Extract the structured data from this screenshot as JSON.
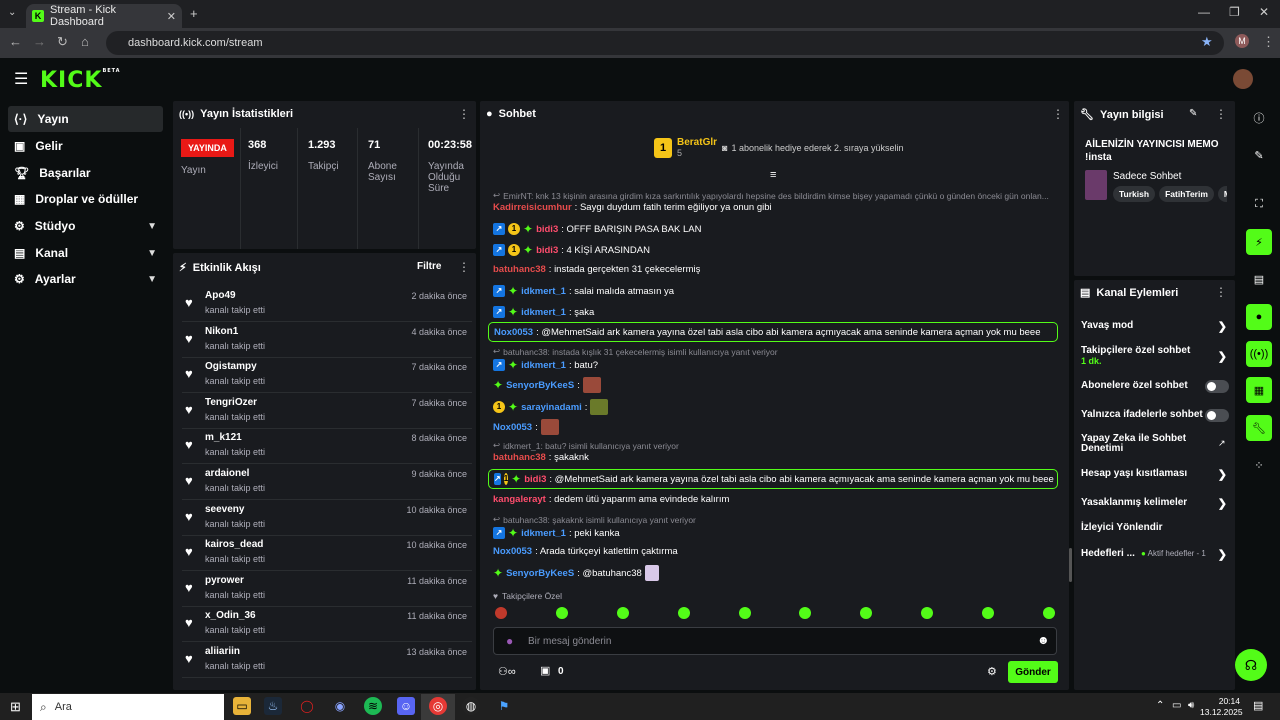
{
  "browser": {
    "tab_title": "Stream - Kick Dashboard",
    "url": "dashboard.kick.com/stream",
    "avatar_letter": "M"
  },
  "kick": {
    "logo": "KICK",
    "logo_sup": "BETA"
  },
  "sidebar": {
    "items": [
      {
        "label": "Yayın"
      },
      {
        "label": "Gelir"
      },
      {
        "label": "Başarılar"
      },
      {
        "label": "Droplar ve ödüller"
      },
      {
        "label": "Stüdyo"
      },
      {
        "label": "Kanal"
      },
      {
        "label": "Ayarlar"
      }
    ]
  },
  "stats": {
    "title": "Yayın İstatistikleri",
    "live": "YAYINDA",
    "live_label": "Yayın",
    "viewers": "368",
    "viewers_label": "İzleyici",
    "followers": "1.293",
    "followers_label": "Takipçi",
    "subs": "71",
    "subs_label": "Abone Sayısı",
    "duration": "00:23:58",
    "duration_label": "Yayında Olduğu Süre"
  },
  "activity": {
    "title": "Etkinlik Akışı",
    "filter": "Filtre",
    "sub": "kanalı takip etti",
    "events": [
      {
        "name": "Apo49",
        "time": "2 dakika önce"
      },
      {
        "name": "Nikon1",
        "time": "4 dakika önce"
      },
      {
        "name": "Ogistampy",
        "time": "7 dakika önce"
      },
      {
        "name": "TengriOzer",
        "time": "7 dakika önce"
      },
      {
        "name": "m_k121",
        "time": "8 dakika önce"
      },
      {
        "name": "ardaionel",
        "time": "9 dakika önce"
      },
      {
        "name": "seeveny",
        "time": "10 dakika önce"
      },
      {
        "name": "kairos_dead",
        "time": "10 dakika önce"
      },
      {
        "name": "pyrower",
        "time": "11 dakika önce"
      },
      {
        "name": "x_Odin_36",
        "time": "11 dakika önce"
      },
      {
        "name": "aliiariin",
        "time": "13 dakika önce"
      }
    ]
  },
  "chat": {
    "title": "Sohbet",
    "top_gifter": "BeratGlr",
    "top_gifter_count": "5",
    "gift_msg": "1 abonelik hediye ederek 2. sıraya yükselin",
    "l0": "EmirNT: knk 13 kişinin arasına girdim kıza sarkıntılık yapıyolardı hepsine des bildirdim kimse bişey yapamadı çünkü o günden önceki gün onlan...",
    "l1u": "Kadirreisicumhur",
    "l1m": ": Saygı duydum fatih terim eğiliyor ya onun gibi",
    "l2u": "bidi3",
    "l2m": ": OFFF BARIŞIN PASA BAK LAN",
    "l3u": "bidi3",
    "l3m": ": 4 KİŞİ ARASINDAN",
    "l4u": "batuhanc38",
    "l4m": ": instada gerçekten 31 çekecelermiş",
    "l5u": "idkmert_1",
    "l5m": ": salai malıda atmasın ya",
    "l6u": "idkmert_1",
    "l6m": ": şaka",
    "l7u": "Nox0053",
    "l7m": ": @MehmetSaid ark kamera yayına özel tabi asla cibo abi kamera açmıyacak ama seninde kamera açman yok mu beee",
    "r1": "batuhanc38: instada kışlık 31 çekecelermiş isimli kullanıcıya yanıt veriyor",
    "l8u": "idkmert_1",
    "l8m": ": batu?",
    "l9u": "SenyorByKeeS",
    "l9m": ":",
    "l10u": "sarayinadami",
    "l10m": ":",
    "l11u": "Nox0053",
    "l11m": ":",
    "r2": "idkmert_1: batu? isimli kullanıcıya yanıt veriyor",
    "l12u": "batuhanc38",
    "l12m": ": şakaknk",
    "l13u": "bidi3",
    "l13m": ": @MehmetSaid ark kamera yayına özel tabi asla cibo abi kamera açmıyacak ama seninde kamera açman yok mu beee",
    "l14u": "kangalerayt",
    "l14m": ": dedem ütü yaparım ama evindede kalırım",
    "r3": "batuhanc38: şakaknk isimli kullanıcıya yanıt veriyor",
    "l15u": "idkmert_1",
    "l15m": ": peki kanka",
    "l16u": "Nox0053",
    "l16m": ": Arada türkçeyi katlettim çaktırma",
    "l17u": "SenyorByKeeS",
    "l17m": ": @batuhanc38",
    "followers_only": "Takipçilere Özel",
    "placeholder": "Bir mesaj gönderin",
    "send": "Gönder",
    "gift_count": "0"
  },
  "info": {
    "title": "Yayın bilgisi",
    "stream_title": "AİLENİZİN YAYINCISI MEMO !insta",
    "category": "Sadece Sohbet",
    "tags": [
      "Turkish",
      "FatihTerim",
      "M"
    ]
  },
  "actions": {
    "title": "Kanal Eylemleri",
    "slow": "Yavaş mod",
    "followers_chat": "Takipçilere özel sohbet",
    "followers_chat_sub": "1 dk.",
    "subs_chat": "Abonelere özel sohbet",
    "emote_chat": "Yalnızca ifadelerle sohbet",
    "ai": "Yapay Zeka ile Sohbet Denetimi",
    "age": "Hesap yaşı kısıtlaması",
    "banned": "Yasaklanmış kelimeler",
    "redirect": "İzleyici Yönlendir",
    "goals": "Hedefleri ...",
    "goals_sub": "Aktif hedefler - 1"
  },
  "taskbar": {
    "search": "Ara",
    "time": "20:14",
    "date": "13.12.2025"
  }
}
